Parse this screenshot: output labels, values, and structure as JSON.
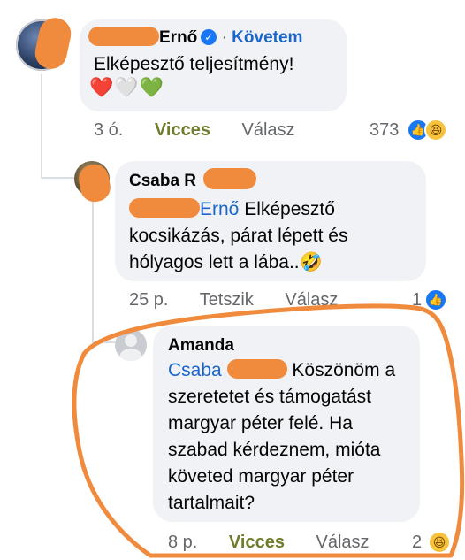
{
  "comment1": {
    "author_suffix": "Ernő",
    "follow_label": "Követem",
    "text": "Elképesztő teljesítmény!",
    "hearts": [
      "❤️",
      "🤍",
      "💚"
    ],
    "meta": {
      "time": "3 ó.",
      "reaction_label": "Vicces",
      "reply_label": "Válasz"
    },
    "reaction_count": "373"
  },
  "comment2": {
    "author_prefix": "Csaba R",
    "mention_suffix": "Ernő",
    "text_lines": [
      "Elképesztő",
      "kocsikázás, párat lépett és",
      "hólyagos lett a lába..🤣"
    ],
    "meta": {
      "time": "25 p.",
      "reaction_label": "Tetszik",
      "reply_label": "Válasz"
    },
    "reaction_count": "1"
  },
  "comment3": {
    "author": "Amanda",
    "mention_prefix": "Csaba",
    "text_lines": [
      "Köszönöm a",
      "szeretetet és támogatást",
      "margyar péter felé. Ha",
      "szabad kérdeznem, mióta",
      "követed margyar péter",
      "tartalmait?"
    ],
    "meta": {
      "time": "8 p.",
      "reaction_label": "Vicces",
      "reply_label": "Válasz"
    },
    "reaction_count": "2"
  },
  "colors": {
    "annotation": "#f08a3c",
    "mention": "#1a66cc",
    "bubble": "#f0f2f5"
  }
}
